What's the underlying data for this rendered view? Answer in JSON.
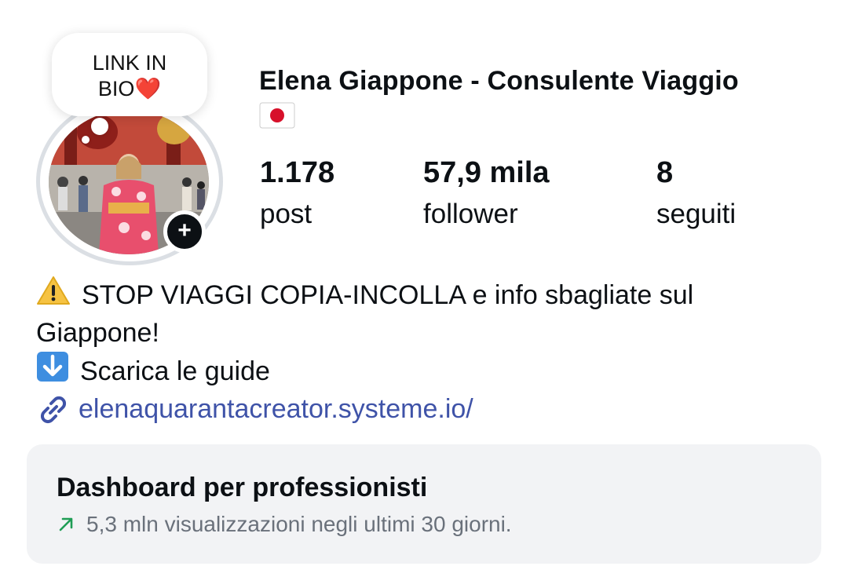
{
  "note": {
    "line1": "LINK IN",
    "line2": "BIO",
    "emoji": "❤️"
  },
  "profile": {
    "name": "Elena Giappone - Consulente Viaggio",
    "flag": "🇯🇵",
    "avatar_icon": "profile-photo"
  },
  "stats": [
    {
      "value": "1.178",
      "label": "post"
    },
    {
      "value": "57,9 mila",
      "label": "follower"
    },
    {
      "value": "8",
      "label": "seguiti"
    }
  ],
  "bio": {
    "line1_emoji": "⚠️",
    "line1_text": "STOP VIAGGI COPIA-INCOLLA e info sbagliate sul",
    "line2_text": "Giappone!",
    "line3_emoji": "⬇️",
    "line3_text": "Scarica le guide",
    "link": "elenaquarantacreator.systeme.io/"
  },
  "dashboard": {
    "title": "Dashboard per professionisti",
    "subtitle": "5,3 mln visualizzazioni negli ultimi 30 giorni."
  },
  "colors": {
    "link": "#3f53a8",
    "trend": "#1f9d55",
    "card_bg": "#f2f3f5"
  }
}
